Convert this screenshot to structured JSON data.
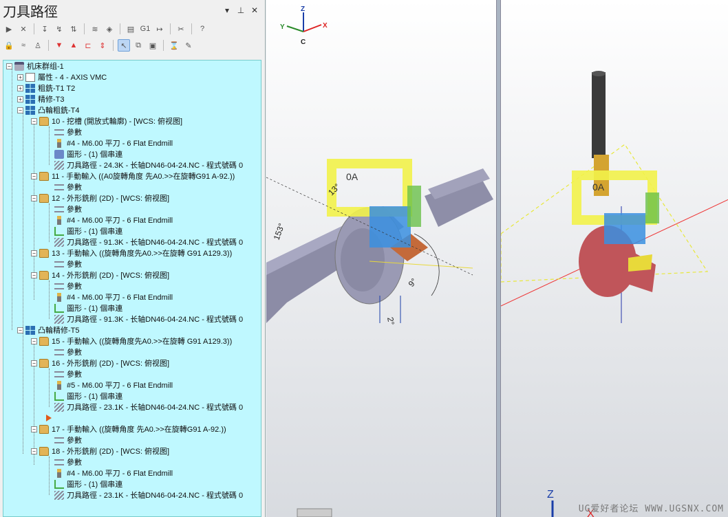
{
  "panel": {
    "title": "刀具路徑",
    "header_buttons": [
      "▾",
      "⊥",
      "✕"
    ]
  },
  "tree": {
    "rows": [
      {
        "label": "机床群组-1"
      },
      {
        "label": "屬性 - 4 - AXIS VMC"
      },
      {
        "label": "粗銑-T1 T2"
      },
      {
        "label": "精修-T3"
      },
      {
        "label": "凸輪粗銑-T4"
      },
      {
        "label": "10 - 挖槽 (開放式輪廓) - [WCS: 俯视图]"
      },
      {
        "label": "參數"
      },
      {
        "label": "#4 - M6.00 平刀 - 6 Flat Endmill"
      },
      {
        "label": "圖形 - (1) 個串連"
      },
      {
        "label": "刀具路徑 - 24.3K - 长轴DN46-04-24.NC - 程式號碼 0"
      },
      {
        "label": "11 - 手動輸入 ((A0旋轉角度 先A0.>>在旋轉G91 A-92.))"
      },
      {
        "label": "參數"
      },
      {
        "label": "12 - 外形銑削 (2D) - [WCS: 俯视图]"
      },
      {
        "label": "參數"
      },
      {
        "label": "#4 - M6.00 平刀 - 6 Flat Endmill"
      },
      {
        "label": "圖形 - (1) 個串連"
      },
      {
        "label": "刀具路徑 - 91.3K - 长轴DN46-04-24.NC - 程式號碼 0"
      },
      {
        "label": "13 - 手動輸入 ((旋轉角度先A0.>>在旋轉 G91 A129.3))"
      },
      {
        "label": "參數"
      },
      {
        "label": "14 - 外形銑削 (2D) - [WCS: 俯视图]"
      },
      {
        "label": "參數"
      },
      {
        "label": "#4 - M6.00 平刀 - 6 Flat Endmill"
      },
      {
        "label": "圖形 - (1) 個串連"
      },
      {
        "label": "刀具路徑 - 91.3K - 长轴DN46-04-24.NC - 程式號碼 0"
      },
      {
        "label": "凸輪精修-T5"
      },
      {
        "label": "15 - 手動輸入 ((旋轉角度先A0.>>在旋轉 G91 A129.3))"
      },
      {
        "label": "參數"
      },
      {
        "label": "16 - 外形銑削 (2D) - [WCS: 俯视图]"
      },
      {
        "label": "參數"
      },
      {
        "label": "#5 - M6.00 平刀 - 6 Flat Endmill"
      },
      {
        "label": "圖形 - (1) 個串連"
      },
      {
        "label": "刀具路徑 - 23.1K - 长轴DN46-04-24.NC - 程式號碼 0"
      },
      {
        "label": ""
      },
      {
        "label": "17 - 手動輸入 ((旋轉角度 先A0.>>在旋轉G91 A-92.))"
      },
      {
        "label": "參數"
      },
      {
        "label": "18 - 外形銑削 (2D) - [WCS: 俯视图]"
      },
      {
        "label": "參數"
      },
      {
        "label": "#4 - M6.00 平刀 - 6 Flat Endmill"
      },
      {
        "label": "圖形 - (1) 個串連"
      },
      {
        "label": "刀具路徑 - 23.1K - 长轴DN46-04-24.NC - 程式號碼 0"
      }
    ]
  },
  "toolbar1": [
    "select-all-icon",
    "select-invalid-icon",
    "regen-selected-icon",
    "regen-dirty-icon",
    "backplot-icon",
    "verify-icon",
    "simulate-icon",
    "post-icon",
    "highspeed-icon",
    "g1-icon",
    "delete-icon",
    "help-icon"
  ],
  "toolbar1_g1": "G1",
  "view1": {
    "axis_z": "Z",
    "axis_y": "Y",
    "axis_x": "X",
    "axis_c": "C",
    "dim_oa": "0A",
    "dim_1": "13°",
    "dim_2": "153°",
    "dim_3": "9°",
    "dim_4": "2°"
  },
  "view2": {
    "dim_oa": "0A",
    "axis_z": "Z",
    "axis_x": "X"
  },
  "watermark": "UG爱好者论坛 WWW.UGSNX.COM",
  "colors": {
    "tree_bg": "#bff8ff",
    "toolpath_yellow": "#f2f24a",
    "toolpath_blue": "#3a8fe0",
    "cam_red": "#c0555a"
  }
}
